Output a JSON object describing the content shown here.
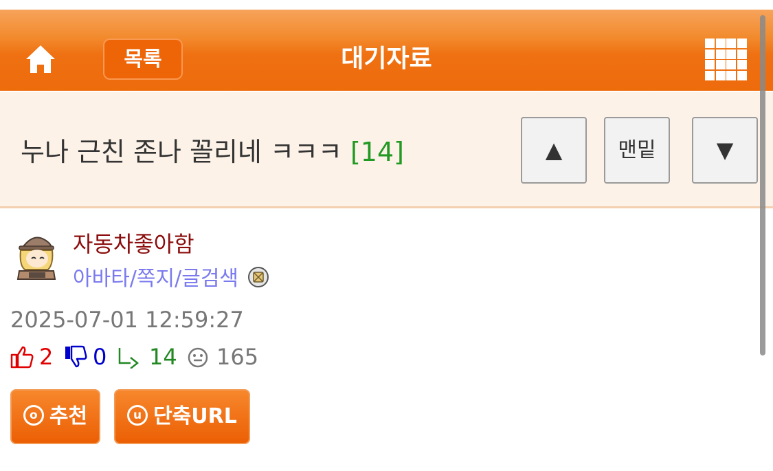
{
  "header": {
    "title": "대기자료",
    "list_button": "목록",
    "home_icon": "home-icon",
    "menu_icon": "grid-menu-icon"
  },
  "post": {
    "title": "누나 근친 존나 꼴리네 ㅋㅋㅋ",
    "comment_count": "[14]",
    "author": "자동차좋아함",
    "author_links": "아바타/쪽지/글검색",
    "date": "2025-07-01 12:59:27"
  },
  "nav": {
    "up": "▲",
    "bottom": "맨밑",
    "down": "▼"
  },
  "stats": {
    "likes": "2",
    "dislikes": "0",
    "replies": "14",
    "views": "165"
  },
  "actions": {
    "recommend_icon": "ⓞ",
    "recommend": "추천",
    "shorturl_icon": "ⓤ",
    "shorturl": "단축URL"
  },
  "colors": {
    "header_orange": "#ee6b0c",
    "author": "#8b0d0d",
    "links": "#7a7aee",
    "likes": "#e00000",
    "dislikes": "#0000cc",
    "replies": "#228822",
    "views": "#777777"
  }
}
